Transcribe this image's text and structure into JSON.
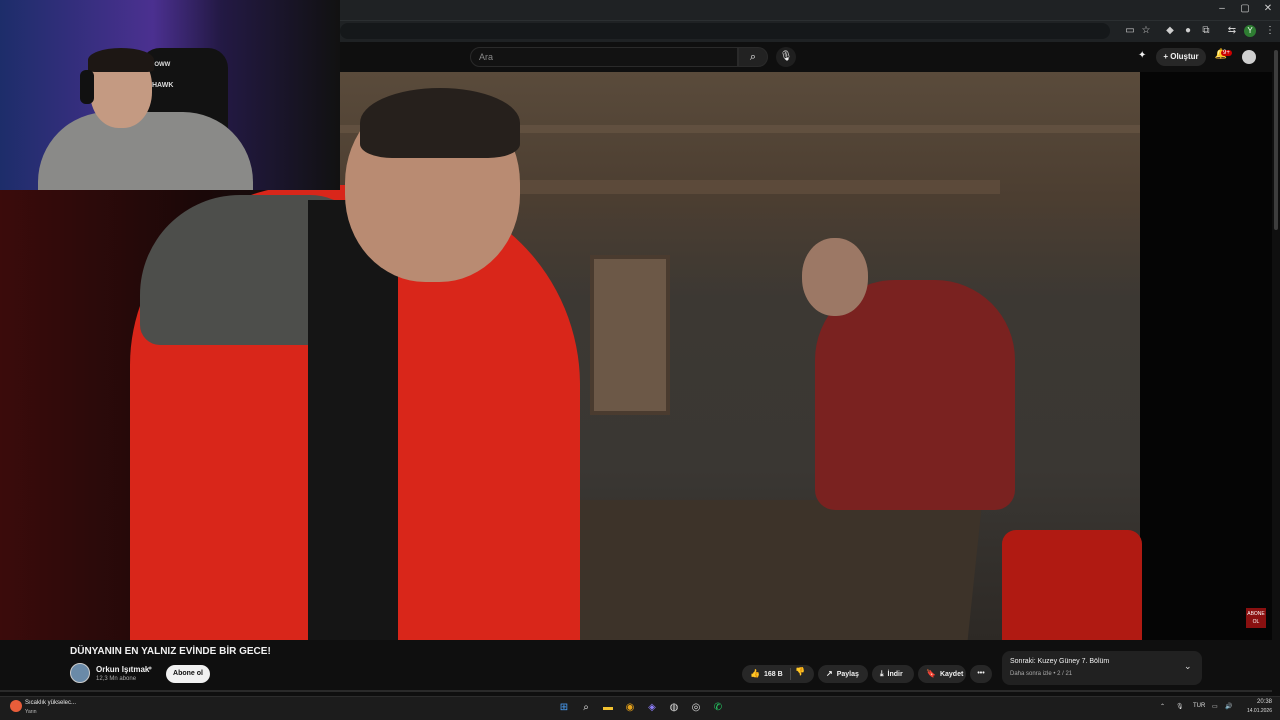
{
  "browser": {
    "window_controls": [
      "–",
      "▢",
      "✕"
    ],
    "profile_initial": "Y"
  },
  "youtube": {
    "search": {
      "placeholder": "Ara"
    },
    "create_label": "Oluştur",
    "notification_count": "9+"
  },
  "video": {
    "title": "DÜNYANIN EN YALNIZ EVİNDE BİR GECE!",
    "endscreen_badge": "ABONE OL"
  },
  "webcam": {
    "chair_brand": "HAWK",
    "chair_brand_top": "NOWW"
  },
  "channel": {
    "name": "Orkun Işıtmak",
    "subscribers": "12,3 Mn abone",
    "subscribe_label": "Abone ol"
  },
  "actions": {
    "like_count": "168 B",
    "share_label": "Paylaş",
    "download_label": "İndir",
    "save_label": "Kaydet",
    "more_label": "•••"
  },
  "up_next": {
    "title": "Sonraki: Kuzey Güney 7. Bölüm",
    "subtitle": "Daha sonra izle • 2 / 21"
  },
  "taskbar": {
    "weather_line1": "Sıcaklık yükselec...",
    "weather_line2": "Yarın",
    "language": "TUR",
    "time": "20:38",
    "date": "14.01.2026"
  },
  "colors": {
    "background": "#0f0f0f",
    "pill": "#272727",
    "subscribe_bg": "#f1f1f1",
    "jacket_red": "#d9261a"
  },
  "icons": [
    "search-icon",
    "mic-icon",
    "plus-icon",
    "bell-icon",
    "like-icon",
    "dislike-icon",
    "share-icon",
    "download-icon",
    "save-icon",
    "chevron-down-icon",
    "windows-start-icon"
  ]
}
